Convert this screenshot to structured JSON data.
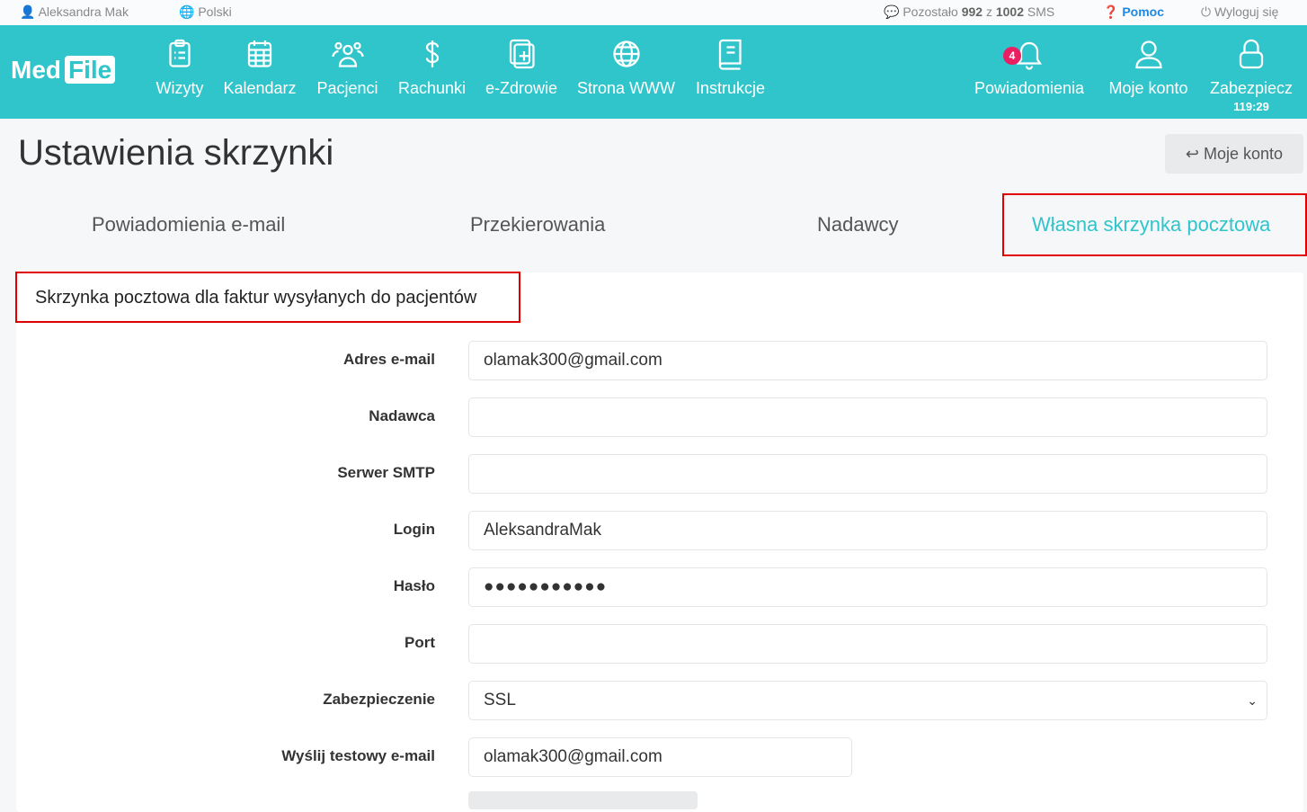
{
  "topbar": {
    "user": "Aleksandra Mak",
    "language": "Polski",
    "sms_prefix": "Pozostało",
    "sms_left": "992",
    "sms_mid": "z",
    "sms_total": "1002",
    "sms_suffix": "SMS",
    "help": "Pomoc",
    "logout": "Wyloguj się"
  },
  "logo": {
    "part1": "Med",
    "part2": "File"
  },
  "nav": {
    "items": [
      "Wizyty",
      "Kalendarz",
      "Pacjenci",
      "Rachunki",
      "e-Zdrowie",
      "Strona WWW",
      "Instrukcje"
    ],
    "notifications": "Powiadomienia",
    "notification_count": "4",
    "account": "Moje konto",
    "lock": "Zabezpiecz",
    "lock_timer": "119:29"
  },
  "page": {
    "title": "Ustawienia skrzynki",
    "back_button": "Moje konto"
  },
  "tabs": [
    {
      "label": "Powiadomienia e-mail"
    },
    {
      "label": "Przekierowania"
    },
    {
      "label": "Nadawcy"
    },
    {
      "label": "Własna skrzynka pocztowa",
      "active": true
    }
  ],
  "card": {
    "title": "Skrzynka pocztowa dla faktur wysyłanych do pacjentów"
  },
  "form": {
    "fields": [
      {
        "label": "Adres e-mail",
        "value": "olamak300@gmail.com"
      },
      {
        "label": "Nadawca",
        "value": ""
      },
      {
        "label": "Serwer SMTP",
        "value": ""
      },
      {
        "label": "Login",
        "value": "AleksandraMak"
      },
      {
        "label": "Hasło",
        "value": "●●●●●●●●●●●"
      },
      {
        "label": "Port",
        "value": ""
      },
      {
        "label": "Zabezpieczenie",
        "value": "SSL"
      },
      {
        "label": "Wyślij testowy e-mail",
        "value": "olamak300@gmail.com"
      }
    ]
  },
  "colors": {
    "brand": "#30c4cb",
    "highlight": "#e00000",
    "badge": "#e91e63",
    "help": "#1e88e5"
  }
}
